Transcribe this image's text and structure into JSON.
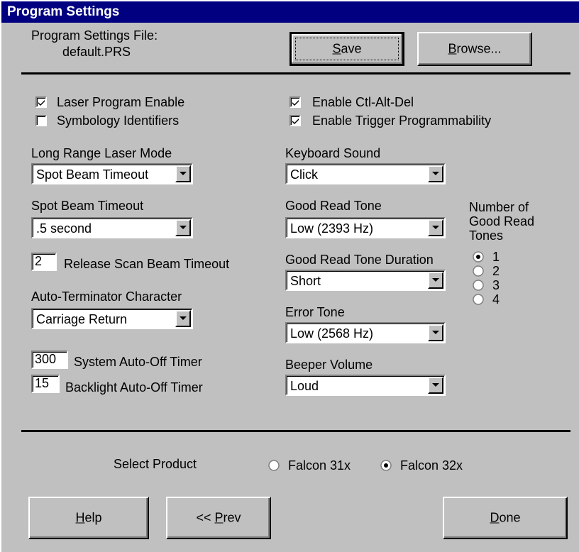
{
  "window": {
    "title": "Program Settings"
  },
  "file": {
    "label": "Program Settings File:",
    "name": "default.PRS"
  },
  "buttons": {
    "save": {
      "prefix": "",
      "key": "S",
      "rest": "ave"
    },
    "browse": {
      "prefix": "",
      "key": "B",
      "rest": "rowse..."
    },
    "help": {
      "prefix": "",
      "key": "H",
      "rest": "elp"
    },
    "prev": {
      "prefix": "<< ",
      "key": "P",
      "rest": "rev"
    },
    "done": {
      "prefix": "",
      "key": "D",
      "rest": "one"
    }
  },
  "checkboxes": {
    "laser_program_enable": {
      "label": "Laser Program Enable",
      "checked": true
    },
    "symbology_identifiers": {
      "label": "Symbology Identifiers",
      "checked": false
    },
    "enable_ctl_alt_del": {
      "label": "Enable Ctl-Alt-Del",
      "checked": true
    },
    "enable_trigger_programmability": {
      "label": "Enable Trigger Programmability",
      "checked": true
    }
  },
  "left": {
    "long_range_laser_mode": {
      "label": "Long Range Laser Mode",
      "value": "Spot Beam Timeout"
    },
    "spot_beam_timeout": {
      "label": "Spot Beam Timeout",
      "value": ".5 second"
    },
    "release_scan_beam_timeout": {
      "label": "Release Scan Beam Timeout",
      "value": "2"
    },
    "auto_terminator_character": {
      "label": "Auto-Terminator Character",
      "value": "Carriage Return"
    },
    "system_auto_off_timer": {
      "label": "System Auto-Off Timer",
      "value": "300"
    },
    "backlight_auto_off_timer": {
      "label": "Backlight Auto-Off Timer",
      "value": "15"
    }
  },
  "middle": {
    "keyboard_sound": {
      "label": "Keyboard Sound",
      "value": "Click"
    },
    "good_read_tone": {
      "label": "Good Read Tone",
      "value": "Low (2393 Hz)"
    },
    "good_read_tone_duration": {
      "label": "Good Read Tone Duration",
      "value": "Short"
    },
    "error_tone": {
      "label": "Error Tone",
      "value": "Low (2568 Hz)"
    },
    "beeper_volume": {
      "label": "Beeper Volume",
      "value": "Loud"
    }
  },
  "tones": {
    "label_line1": "Number of",
    "label_line2": "Good Read",
    "label_line3": "Tones",
    "options": [
      "1",
      "2",
      "3",
      "4"
    ],
    "selected": "1"
  },
  "product": {
    "label": "Select Product",
    "options": [
      "Falcon 31x",
      "Falcon 32x"
    ],
    "selected": "Falcon 32x"
  }
}
